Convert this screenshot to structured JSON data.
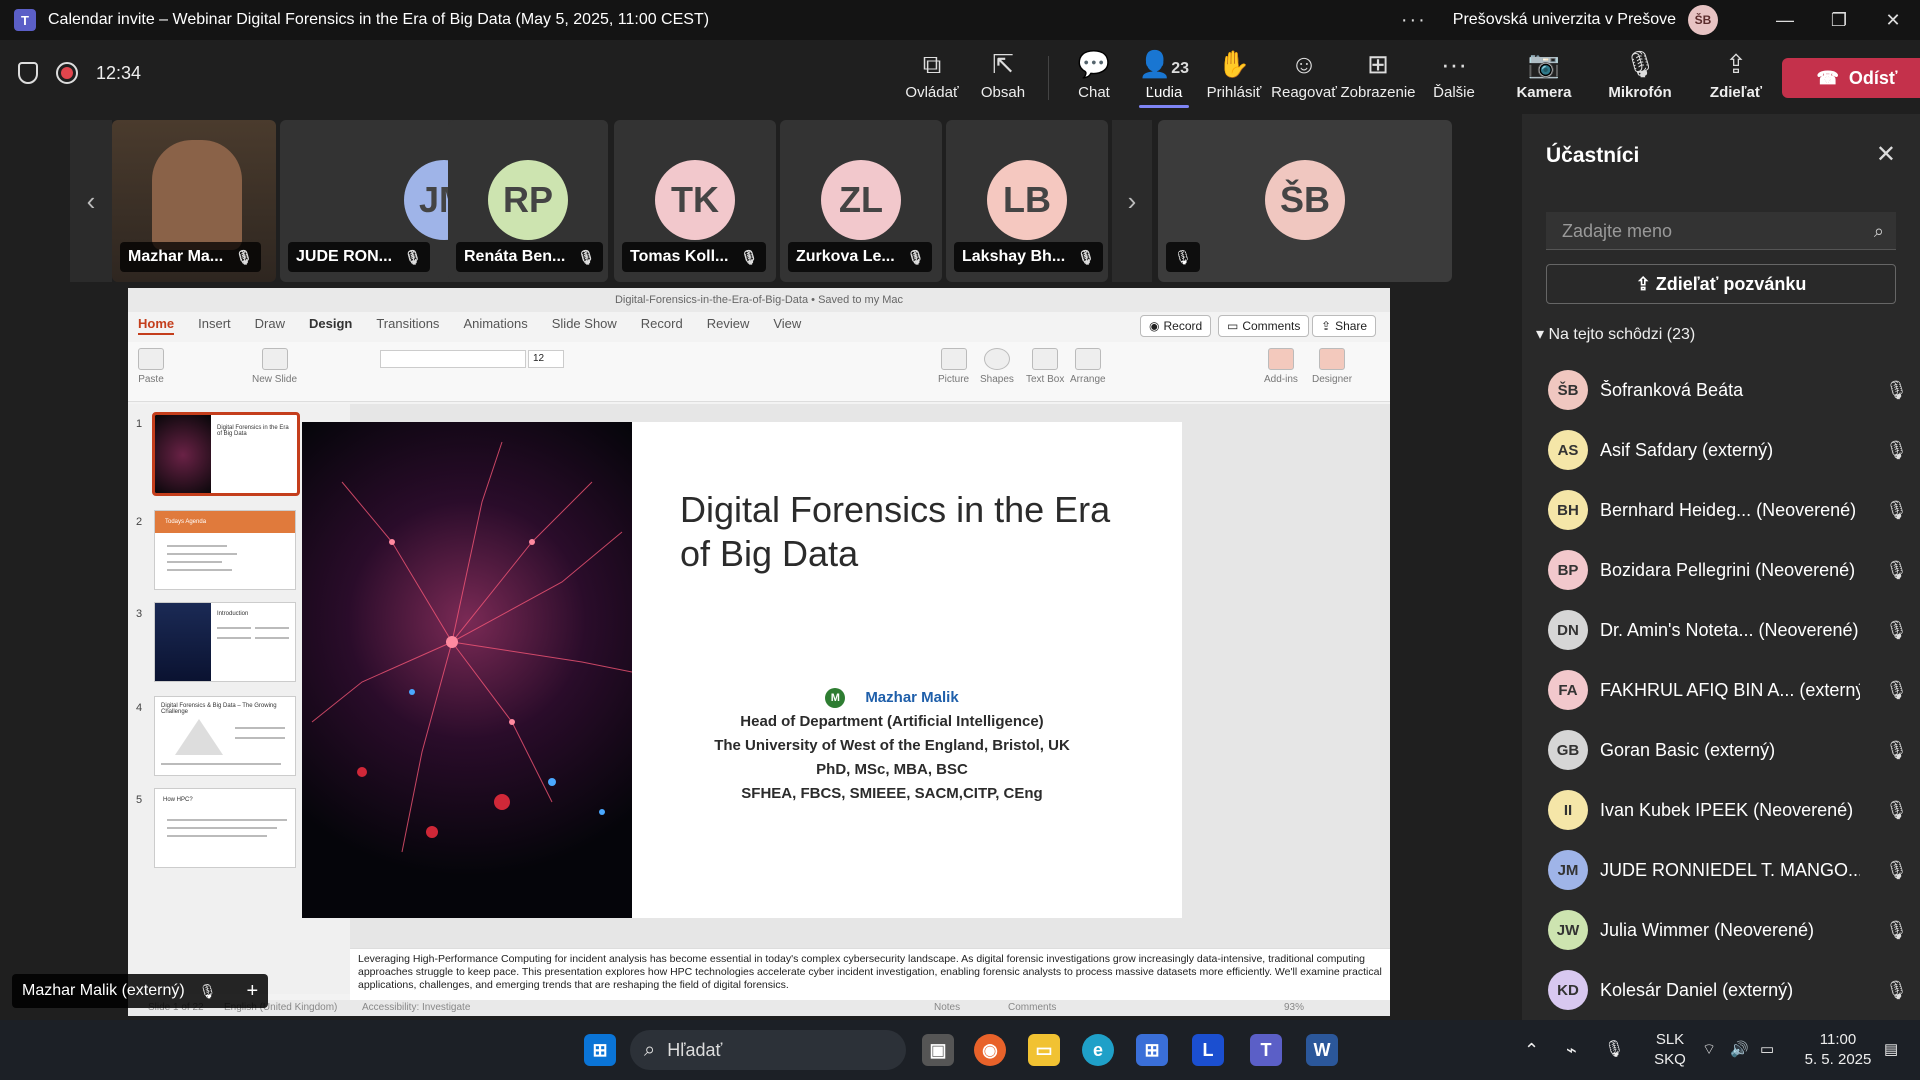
{
  "window": {
    "title": "Calendar invite – Webinar Digital Forensics in the Era of Big Data (May 5, 2025, 11:00 CEST)",
    "org": "Prešovská univerzita v Prešove",
    "org_avatar": "ŠB"
  },
  "meeting": {
    "timer": "12:34",
    "tools": [
      {
        "label": "Ovládať",
        "icon": "control-icon"
      },
      {
        "label": "Obsah",
        "icon": "share-content-icon"
      },
      {
        "label": "Chat",
        "icon": "chat-icon"
      },
      {
        "label": "Ľudia",
        "icon": "people-icon",
        "count": "23"
      },
      {
        "label": "Prihlásiť",
        "icon": "raise-hand-icon"
      },
      {
        "label": "Reagovať",
        "icon": "react-icon"
      },
      {
        "label": "Zobrazenie",
        "icon": "view-icon"
      },
      {
        "label": "Ďalšie",
        "icon": "more-icon"
      },
      {
        "label": "Kamera",
        "icon": "camera-off-icon"
      },
      {
        "label": "Mikrofón",
        "icon": "mic-off-icon"
      },
      {
        "label": "Zdieľať",
        "icon": "share-icon"
      }
    ],
    "leave_label": "Odísť"
  },
  "strip": [
    {
      "name": "Mazhar Ma...",
      "initials": "",
      "color": "#6b5a4a"
    },
    {
      "name": "JUDE RON...",
      "initials": "JM",
      "color": "#9fb4e8"
    },
    {
      "name": "Renáta Ben...",
      "initials": "RP",
      "color": "#cde4b0"
    },
    {
      "name": "Tomas Koll...",
      "initials": "TK",
      "color": "#f2c8cc"
    },
    {
      "name": "Zurkova Le...",
      "initials": "ZL",
      "color": "#f2c8cc"
    },
    {
      "name": "Lakshay Bh...",
      "initials": "LB",
      "color": "#f5c8c0"
    },
    {
      "name": "",
      "initials": "ŠB",
      "color": "#f0c7c0"
    }
  ],
  "ppt": {
    "doc_title": "Digital-Forensics-in-the-Era-of-Big-Data • Saved to my Mac",
    "tabs": [
      "Home",
      "Insert",
      "Draw",
      "Design",
      "Transitions",
      "Animations",
      "Slide Show",
      "Record",
      "Review",
      "View"
    ],
    "record_btn": "Record",
    "comments_btn": "Comments",
    "share_btn": "Share",
    "ribbon": [
      "Paste",
      "New Slide",
      "Picture",
      "Shapes",
      "Text Box",
      "Arrange",
      "Add-ins",
      "Designer"
    ],
    "font_size": "12",
    "thumbs": [
      {
        "num": "1",
        "title": "Digital Forensics in the Era of Big Data"
      },
      {
        "num": "2",
        "title": "Todays Agenda"
      },
      {
        "num": "3",
        "title": "Introduction"
      },
      {
        "num": "4",
        "title": "Digital Forensics & Big Data – The Growing Challenge"
      },
      {
        "num": "5",
        "title": "How HPC?"
      }
    ],
    "slide": {
      "title": "Digital Forensics in the Era of Big Data",
      "presenter_badge": "M",
      "presenter": "Mazhar Malik",
      "lines": [
        "Head of Department (Artificial Intelligence)",
        "The University of West of the England, Bristol, UK",
        "PhD, MSc, MBA, BSC",
        "SFHEA, FBCS, SMIEEE, SACM,CITP, CEng"
      ]
    },
    "notes": "Leveraging High-Performance Computing for incident analysis has become essential in today's complex cybersecurity landscape. As digital forensic investigations grow increasingly data-intensive, traditional computing approaches struggle to keep pace. This presentation explores how HPC technologies accelerate cyber incident investigation, enabling forensic analysts to process massive datasets more efficiently. We'll examine practical applications, challenges, and emerging trends that are reshaping the field of digital forensics.",
    "status": {
      "slide": "Slide 1 of 22",
      "lang": "English (United Kingdom)",
      "access": "Accessibility: Investigate",
      "notes": "Notes",
      "comments": "Comments",
      "zoom": "93%"
    }
  },
  "presenter_label": "Mazhar Malik (externý)",
  "panel": {
    "title": "Účastníci",
    "search_placeholder": "Zadajte meno",
    "invite_label": "Zdieľať pozvánku",
    "section": "Na tejto schôdzi (23)",
    "people": [
      {
        "initials": "ŠB",
        "name": "Šofranková Beáta",
        "color": "#f0c7c0"
      },
      {
        "initials": "AS",
        "name": "Asif Safdary (externý)",
        "color": "#f5e6a8"
      },
      {
        "initials": "BH",
        "name": "Bernhard Heideg... (Neoverené)",
        "color": "#f5e6a8"
      },
      {
        "initials": "BP",
        "name": "Bozidara Pellegrini (Neoverené)",
        "color": "#f2c8cc"
      },
      {
        "initials": "DN",
        "name": "Dr. Amin's Noteta... (Neoverené)",
        "color": "#d6d6d6"
      },
      {
        "initials": "FA",
        "name": "FAKHRUL AFIQ BIN A... (externý)",
        "color": "#f2c8cc"
      },
      {
        "initials": "GB",
        "name": "Goran Basic (externý)",
        "color": "#d6d6d6"
      },
      {
        "initials": "II",
        "name": "Ivan Kubek IPEEK (Neoverené)",
        "color": "#f5e6a8"
      },
      {
        "initials": "JM",
        "name": "JUDE RONNIEDEL T. MANGO...",
        "color": "#9fb4e8"
      },
      {
        "initials": "JW",
        "name": "Julia Wimmer (Neoverené)",
        "color": "#cde4b0"
      },
      {
        "initials": "KD",
        "name": "Kolesár Daniel (externý)",
        "color": "#d8c8f0"
      }
    ]
  },
  "taskbar": {
    "search_label": "Hľadať",
    "lang": "SLK",
    "layout": "SKQ",
    "time": "11:00",
    "date": "5. 5. 2025"
  }
}
